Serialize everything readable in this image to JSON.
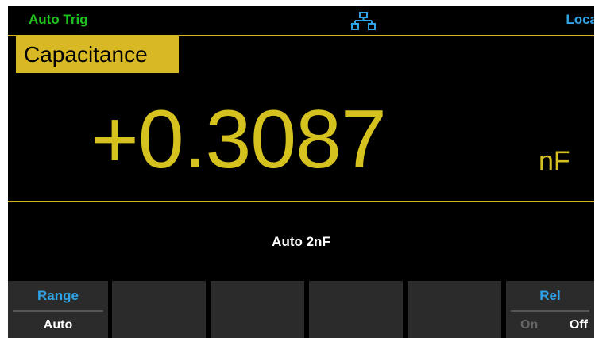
{
  "status_bar": {
    "trigger_mode": "Auto Trig",
    "network_icon": "network-icon",
    "control_mode": "Loca"
  },
  "measurement": {
    "function_label": "Capacitance",
    "reading": "+0.3087",
    "unit": "nF",
    "range_readout": "Auto 2nF"
  },
  "softkeys": {
    "range": {
      "title": "Range",
      "value": "Auto"
    },
    "rel": {
      "title": "Rel",
      "on_label": "On",
      "off_label": "Off",
      "selected": "Off"
    }
  },
  "colors": {
    "accent_yellow": "#d6c21f",
    "label_blue": "#2fa3e6",
    "trigger_green": "#1ec21e",
    "background": "#000000",
    "softkey_bg": "#2b2b2b"
  }
}
